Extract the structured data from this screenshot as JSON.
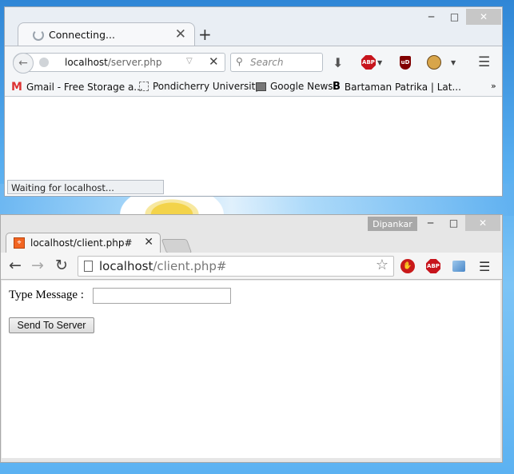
{
  "firefox": {
    "tab_title": "Connecting...",
    "url_host": "localhost",
    "url_path": "/server.php",
    "search_placeholder": "Search",
    "bookmarks": [
      {
        "label": "Gmail - Free Storage a..."
      },
      {
        "label": "Pondicherry University"
      },
      {
        "label": "Google News"
      },
      {
        "label": "Bartaman Patrika | Lat..."
      }
    ],
    "bookmarks_overflow": "»",
    "status_text": "Waiting for localhost...",
    "icons": {
      "abp": "ABP",
      "ublock": "uD"
    }
  },
  "chrome": {
    "profile_name": "Dipankar",
    "tab_title": "localhost/client.php#",
    "url_host": "localhost",
    "url_path": "/client.php#",
    "page": {
      "label": "Type Message :",
      "input_value": "",
      "button_label": "Send To Server"
    },
    "icons": {
      "abp": "ABP"
    }
  }
}
